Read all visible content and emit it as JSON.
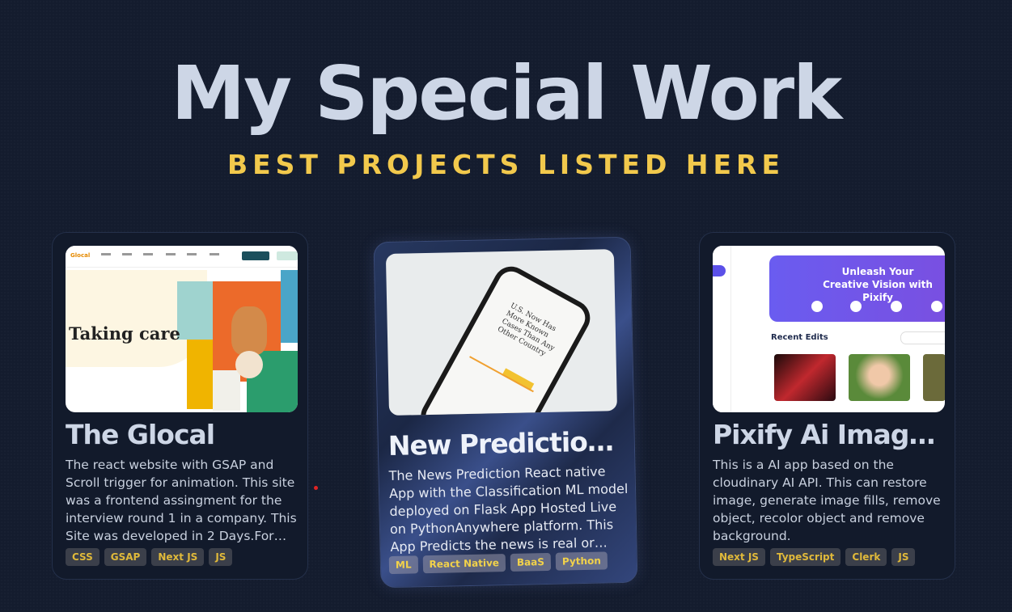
{
  "header": {
    "title": "My Special Work",
    "subtitle": "BEST PROJECTS LISTED HERE"
  },
  "projects": [
    {
      "title": "The Glocal",
      "description": "The react website with GSAP and Scroll trigger for animation. This site was a frontend assingment for the interview round 1 in a company. This Site was developed in 2 Days.For the...",
      "tags": [
        "CSS",
        "GSAP",
        "Next JS",
        "JS"
      ],
      "thumb": {
        "logo": "Glocal",
        "hero_text": "Taking care"
      }
    },
    {
      "title": "New Prediction R...",
      "description": "The News Prediction React native App with the Classification ML model deployed on Flask App Hosted Live on PythonAnywhere platform. This App Predicts the news is real or fake.",
      "tags": [
        "ML",
        "React Native",
        "BaaS",
        "Python"
      ],
      "thumb": {
        "screen_text": "U.S. Now Has More Known Cases Than Any Other Country"
      }
    },
    {
      "title": "Pixify Ai Image S...",
      "description": "This is a AI app based on the cloudinary AI API. This can restore image, generate image fills, remove object, recolor object and remove background.",
      "tags": [
        "Next JS",
        "TypeScript",
        "Clerk",
        "JS"
      ],
      "thumb": {
        "banner": "Unleash Your Creative Vision with Pixify",
        "section": "Recent Edits"
      }
    }
  ],
  "colors": {
    "accent": "#f2c94c",
    "title": "#cdd6e6",
    "background": "#141c2e",
    "tag_bg": "#3b3f4a"
  }
}
